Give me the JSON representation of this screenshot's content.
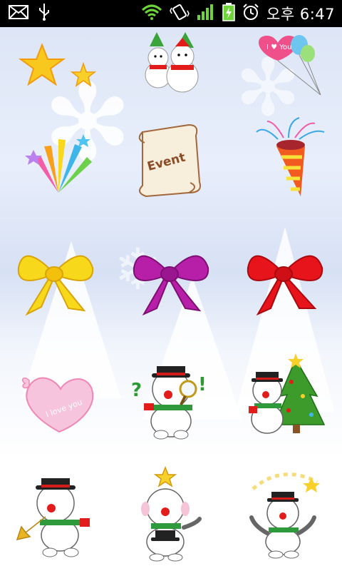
{
  "status_bar": {
    "time": "오후 6:47",
    "icons": [
      "mail-icon",
      "usb-icon",
      "wifi-icon",
      "vibrate-icon",
      "signal-icon",
      "battery-charging-icon",
      "alarm-icon"
    ]
  },
  "stickers": {
    "rows": [
      [
        "stars",
        "snowmen",
        "heart-balloons"
      ],
      [
        "fireworks",
        "event-scroll",
        "party-popper"
      ],
      [
        "yellow-bow",
        "purple-bow",
        "red-bow"
      ],
      [
        "love-heart",
        "snowman-magnifier",
        "snowman-tree"
      ],
      [
        "snowman-trumpet",
        "snowman-star",
        "snowman-arms-up"
      ]
    ],
    "event_label": "Event",
    "heart_text": "I love you",
    "balloon_text": "I ♥ You"
  },
  "colors": {
    "status_bg": "#000000",
    "status_green": "#6fd43a",
    "bow_yellow": "#f7d81a",
    "bow_purple": "#b71fa9",
    "bow_red": "#e8141b",
    "heart_pink": "#f6c4dc"
  }
}
